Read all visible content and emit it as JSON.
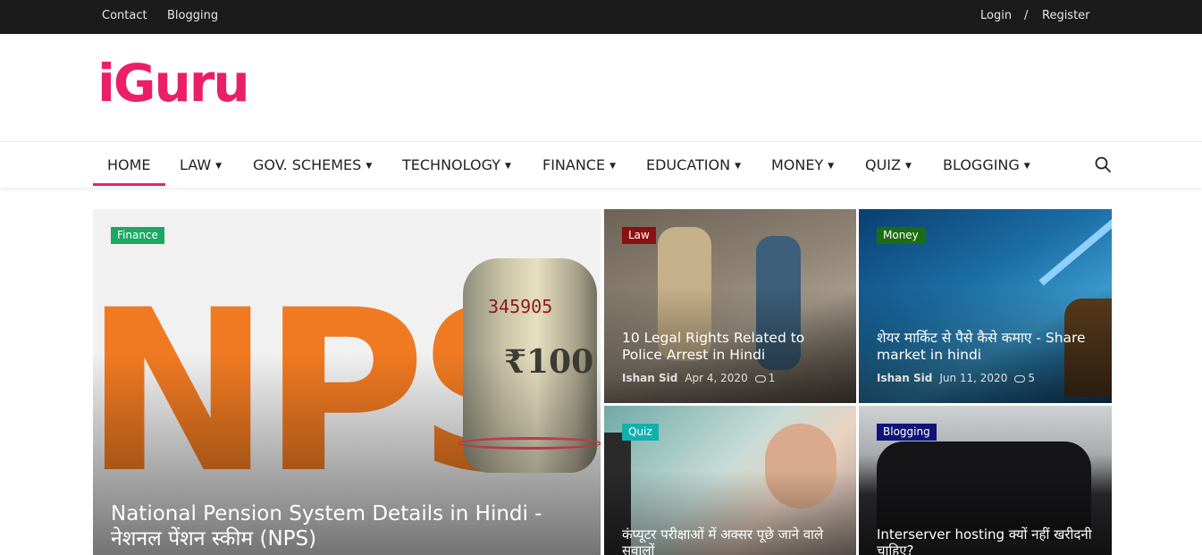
{
  "topbar": {
    "contact": "Contact",
    "blogging": "Blogging",
    "login": "Login",
    "separator": "/",
    "register": "Register"
  },
  "brand": {
    "logo": "iGuru",
    "color": "#ea1f67"
  },
  "nav": {
    "items": [
      {
        "label": "HOME",
        "dropdown": false
      },
      {
        "label": "LAW",
        "dropdown": true
      },
      {
        "label": "GOV. SCHEMES",
        "dropdown": true
      },
      {
        "label": "TECHNOLOGY",
        "dropdown": true
      },
      {
        "label": "FINANCE",
        "dropdown": true
      },
      {
        "label": "EDUCATION",
        "dropdown": true
      },
      {
        "label": "MONEY",
        "dropdown": true
      },
      {
        "label": "QUIZ",
        "dropdown": true
      },
      {
        "label": "BLOGGING",
        "dropdown": true
      }
    ],
    "caret": "▼",
    "active": "HOME",
    "search_icon": "search-icon"
  },
  "posts": [
    {
      "category": "Finance",
      "category_color": "#1aa864",
      "title": "National Pension System Details in Hindi - नेशनल पेंशन स्कीम (NPS)",
      "image": {
        "headline": "NPS",
        "note_number": "345905",
        "note_value": "₹100"
      }
    },
    {
      "category": "Law",
      "category_color": "#8b1111",
      "title": "10 Legal Rights Related to Police Arrest in Hindi",
      "author": "Ishan Sid",
      "date": "Apr 4, 2020",
      "comments": "1"
    },
    {
      "category": "Money",
      "category_color": "#1c6d12",
      "title": "शेयर मार्किट से पैसे कैसे कमाए - Share market in hindi",
      "author": "Ishan Sid",
      "date": "Jun 11, 2020",
      "comments": "5"
    },
    {
      "category": "Quiz",
      "category_color": "#12b0ad",
      "title": "कंप्यूटर परीक्षाओं में अक्सर पूछे जाने वाले सवालों"
    },
    {
      "category": "Blogging",
      "category_color": "#10147a",
      "title": "Interserver hosting क्यों नहीं खरीदनी चाहिए?"
    }
  ]
}
